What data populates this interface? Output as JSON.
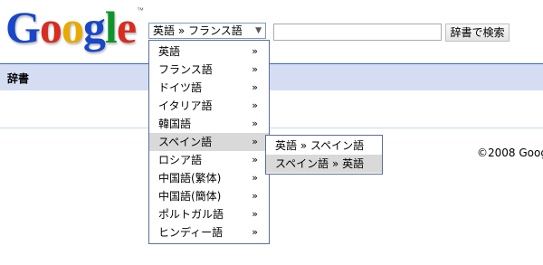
{
  "logo": {
    "letters": [
      {
        "ch": "G",
        "color": "#1a47c8"
      },
      {
        "ch": "o",
        "color": "#d62d20"
      },
      {
        "ch": "o",
        "color": "#e8a900"
      },
      {
        "ch": "g",
        "color": "#1a47c8"
      },
      {
        "ch": "l",
        "color": "#11932b"
      },
      {
        "ch": "e",
        "color": "#d62d20"
      }
    ],
    "trademark": "™"
  },
  "language_select": {
    "value": "英語 » フランス語",
    "arrow": "▼"
  },
  "search": {
    "value": "",
    "button_label": "辞書で検索"
  },
  "section": {
    "title": "辞書"
  },
  "footer": {
    "copyright": "©2008 Goog"
  },
  "menu": {
    "chevron": "»",
    "items": [
      {
        "label": "英語"
      },
      {
        "label": "フランス語"
      },
      {
        "label": "ドイツ語"
      },
      {
        "label": "イタリア語"
      },
      {
        "label": "韓国語"
      },
      {
        "label": "スペイン語",
        "active": true
      },
      {
        "label": "ロシア語"
      },
      {
        "label": "中国語(繁体)"
      },
      {
        "label": "中国語(簡体)"
      },
      {
        "label": "ポルトガル語"
      },
      {
        "label": "ヒンディー語"
      }
    ]
  },
  "submenu": {
    "items": [
      {
        "label": "英語 » スペイン語"
      },
      {
        "label": "スペイン語 » 英語",
        "active": true
      }
    ]
  }
}
